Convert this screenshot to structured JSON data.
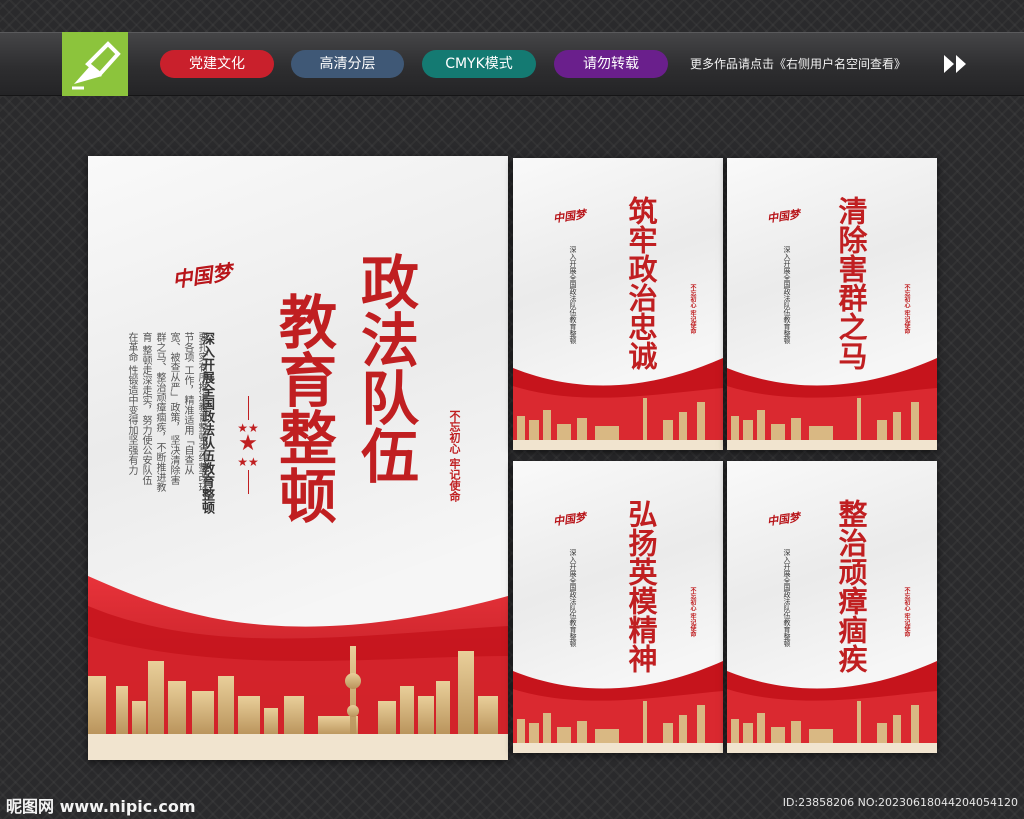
{
  "header": {
    "tags": [
      "党建文化",
      "高清分层",
      "CMYK模式",
      "请勿转载"
    ],
    "more_text": "更多作品请点击《右侧用户名空间查看》"
  },
  "main_poster": {
    "logo_text": "中国梦",
    "title_col1": "政法队伍",
    "title_col2": "教育整顿",
    "subtitle": "深入开展全国政法队伍教育整顿",
    "body_lines": [
      "要扎实有序推进教育整顿查纠整改环节各项",
      "工作，精准适用「自查从宽、被查从严」政策，",
      "坚决清除害群之马、整治顽瘴痼疾，不断推进教育",
      "整顿走深走实，努力使公安队伍在革命",
      "性锻造中变得加坚强有力"
    ],
    "slogan": "不忘初心 牢记使命"
  },
  "small_posters": [
    {
      "title": "筑牢政治忠诚"
    },
    {
      "title": "清除害群之马"
    },
    {
      "title": "弘扬英模精神"
    },
    {
      "title": "整治顽瘴痼疾"
    }
  ],
  "footer": {
    "site": "昵图网 www.nipic.com",
    "id_text": "ID:23858206 NO:20230618044204054120"
  },
  "colors": {
    "primary_red": "#c01f21",
    "logo_green": "#8cc43c"
  }
}
